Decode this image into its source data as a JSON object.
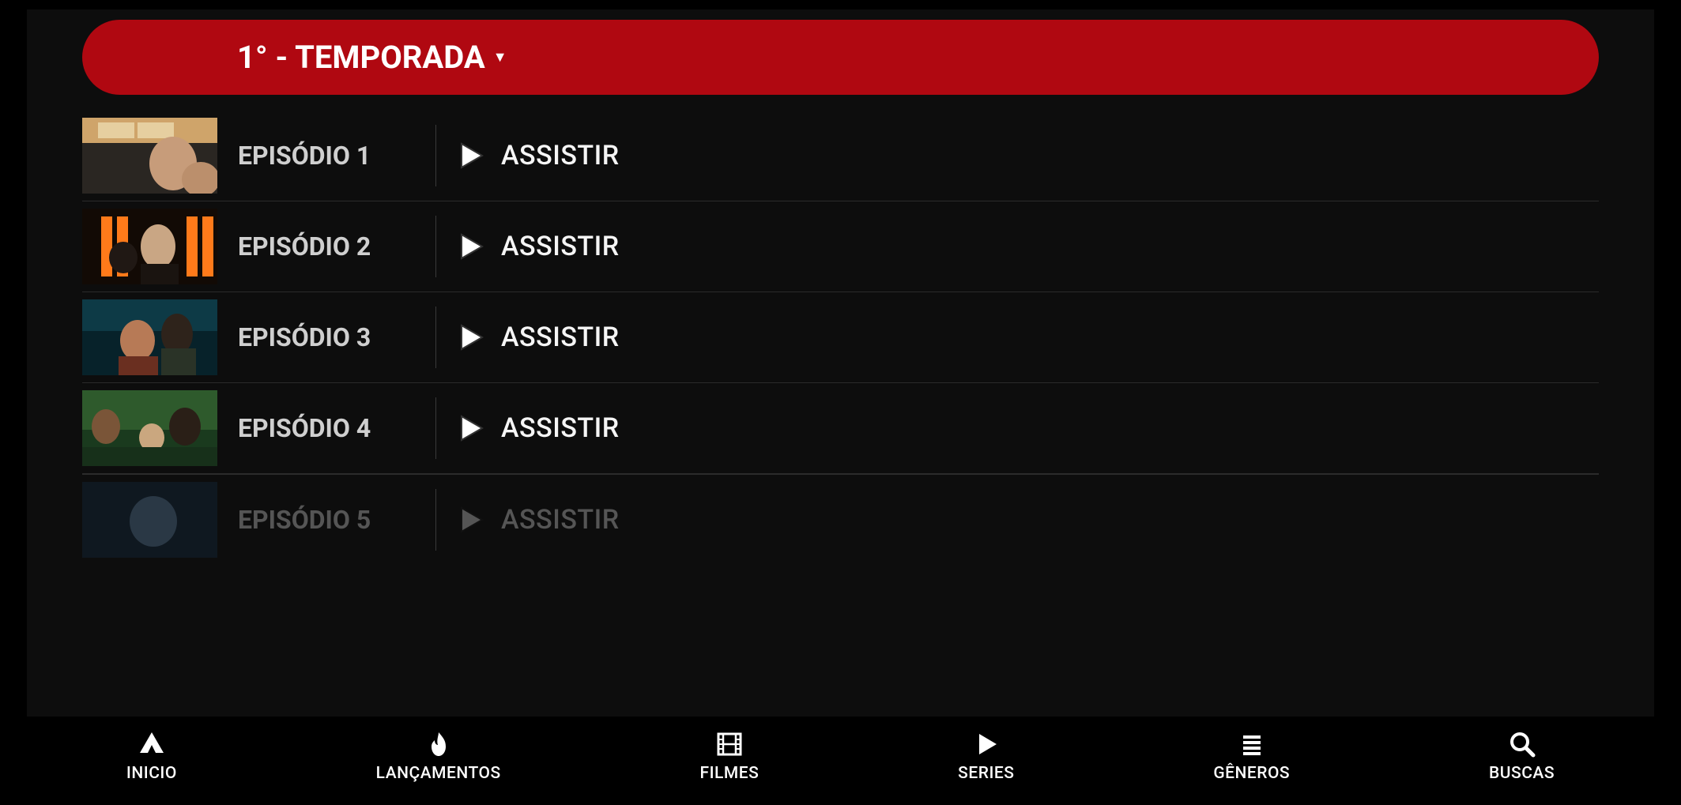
{
  "season_selector": {
    "label": "1° - TEMPORADA"
  },
  "watch_label": "ASSISTIR",
  "episodes": [
    {
      "label": "EPISÓDIO 1"
    },
    {
      "label": "EPISÓDIO 2"
    },
    {
      "label": "EPISÓDIO 3"
    },
    {
      "label": "EPISÓDIO 4"
    },
    {
      "label": "EPISÓDIO 5"
    }
  ],
  "nav": [
    {
      "icon": "home",
      "label": "INICIO"
    },
    {
      "icon": "flame",
      "label": "LANÇAMENTOS"
    },
    {
      "icon": "film",
      "label": "FILMES"
    },
    {
      "icon": "play",
      "label": "SERIES"
    },
    {
      "icon": "list",
      "label": "GÊNEROS"
    },
    {
      "icon": "search",
      "label": "BUSCAS"
    }
  ],
  "colors": {
    "accent": "#b00811",
    "bg": "#0d0d0d"
  }
}
